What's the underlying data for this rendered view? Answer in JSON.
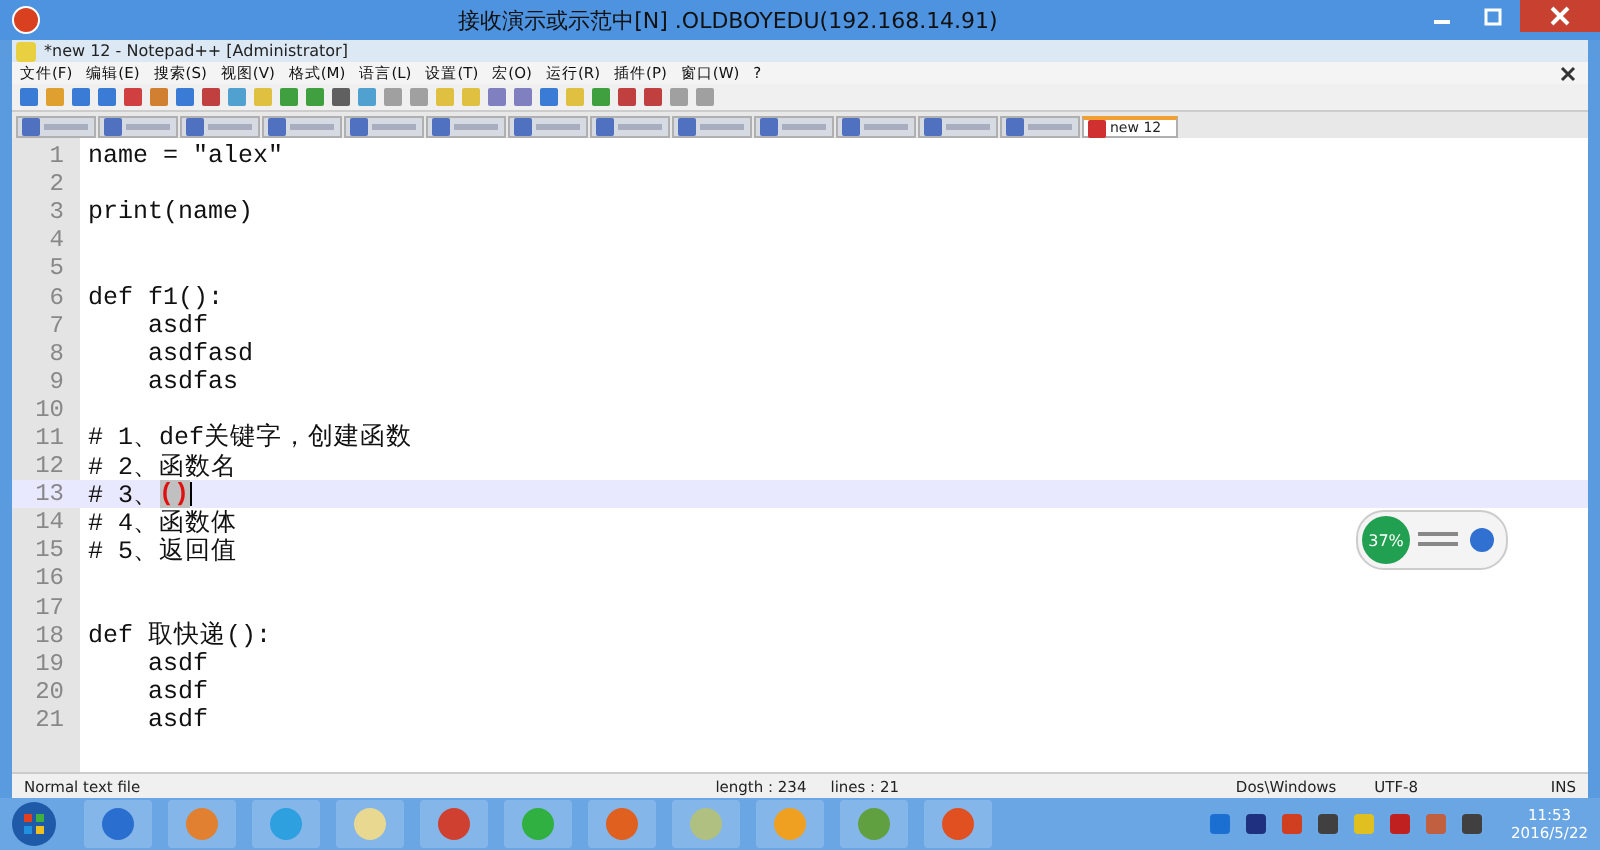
{
  "remote_title": "接收演示或示范中[N] .OLDBOYEDU(192.168.14.91)",
  "window": {
    "title": "*new 12 - Notepad++ [Administrator]"
  },
  "menu": [
    "文件(F)",
    "编辑(E)",
    "搜索(S)",
    "视图(V)",
    "格式(M)",
    "语言(L)",
    "设置(T)",
    "宏(O)",
    "运行(R)",
    "插件(P)",
    "窗口(W)",
    "?"
  ],
  "tabs": [
    {
      "selected": false
    },
    {
      "selected": false
    },
    {
      "selected": false
    },
    {
      "selected": false
    },
    {
      "selected": false
    },
    {
      "selected": false
    },
    {
      "selected": false
    },
    {
      "selected": false
    },
    {
      "selected": false
    },
    {
      "selected": false
    },
    {
      "selected": false
    },
    {
      "selected": false
    },
    {
      "selected": false
    },
    {
      "label": "new 12",
      "selected": true
    }
  ],
  "lines": [
    {
      "num": "1",
      "text": "name = \"alex\"",
      "current": false
    },
    {
      "num": "2",
      "current": false
    },
    {
      "num": "3",
      "text": "print(name)",
      "current": false
    },
    {
      "num": "4",
      "current": false
    },
    {
      "num": "5",
      "current": false
    },
    {
      "num": "6",
      "text": "def f1():",
      "current": false
    },
    {
      "num": "7",
      "text": "    asdf",
      "current": false
    },
    {
      "num": "8",
      "text": "    asdfasd",
      "current": false
    },
    {
      "num": "9",
      "text": "    asdfas",
      "current": false
    },
    {
      "num": "10",
      "current": false
    },
    {
      "num": "11",
      "text": "# 1、def关键字，创建函数",
      "current": false
    },
    {
      "num": "12",
      "text": "# 2、函数名",
      "current": false
    },
    {
      "num": "13",
      "text": "# 3、",
      "brace": "()",
      "current": true
    },
    {
      "num": "14",
      "text": "# 4、函数体",
      "current": false
    },
    {
      "num": "15",
      "text": "# 5、返回值",
      "current": false
    },
    {
      "num": "16",
      "current": false
    },
    {
      "num": "17",
      "current": false
    },
    {
      "num": "18",
      "text": "def 取快递():",
      "current": false
    },
    {
      "num": "19",
      "text": "    asdf",
      "current": false
    },
    {
      "num": "20",
      "text": "    asdf",
      "current": false
    },
    {
      "num": "21",
      "text": "    asdf",
      "current": false
    }
  ],
  "network_widget": {
    "percent": "37%"
  },
  "status_bar": {
    "type": "Normal text file",
    "length": "length : 234",
    "lines": "lines : 21",
    "eol": "Dos\\Windows",
    "encoding": "UTF-8",
    "mode": "INS"
  },
  "taskbar": {
    "time": "11:53",
    "date": "2016/5/22"
  }
}
